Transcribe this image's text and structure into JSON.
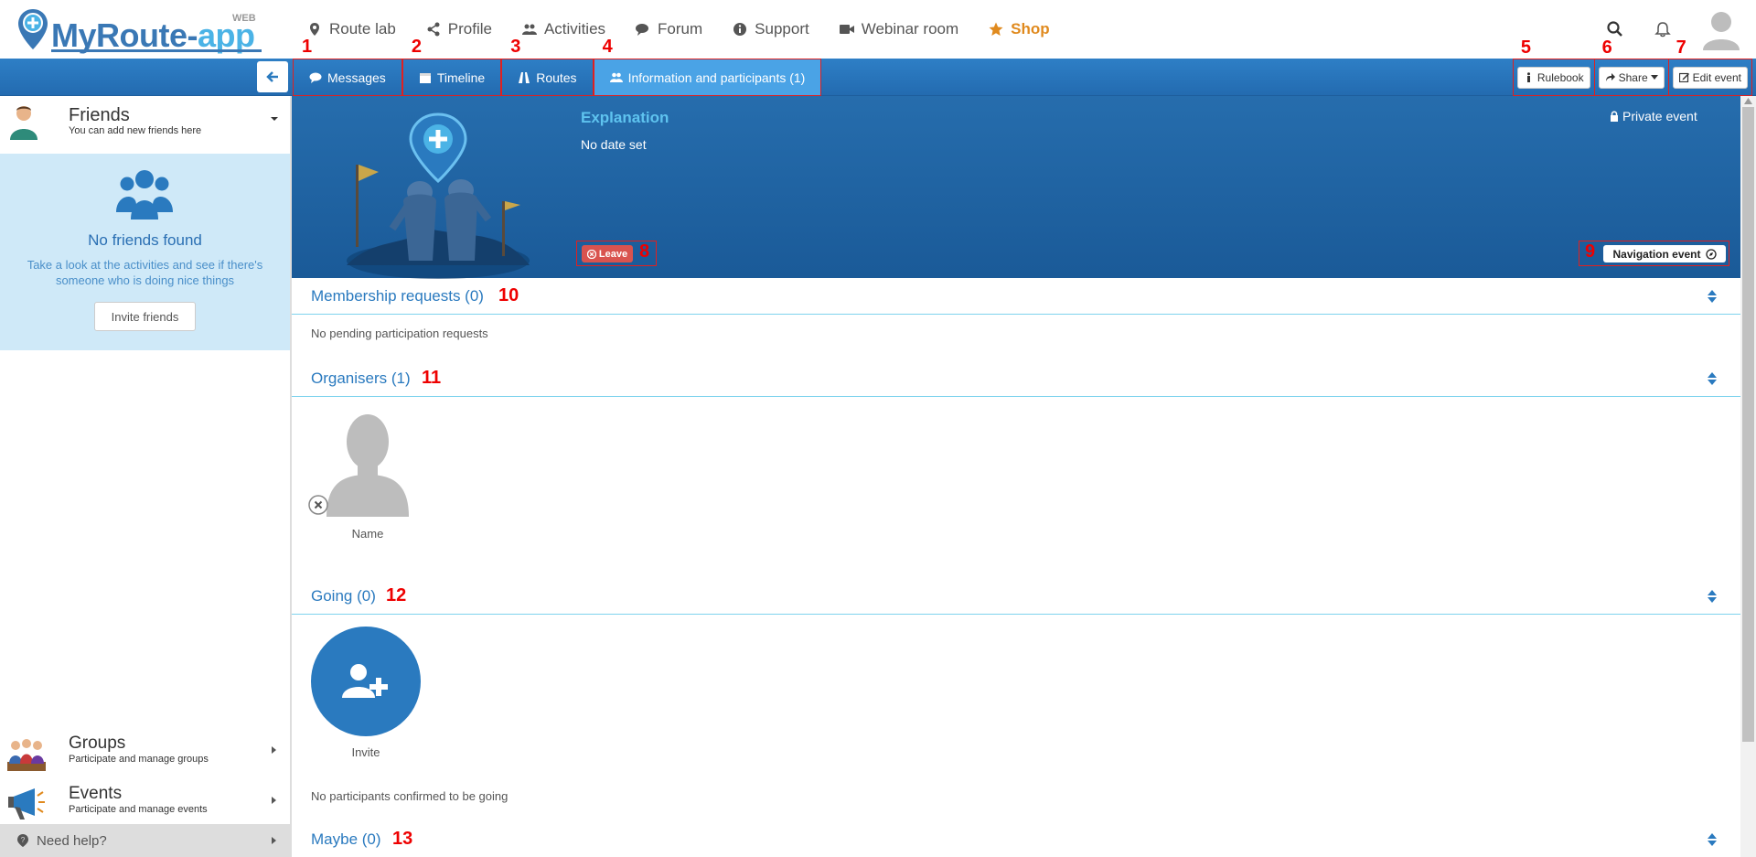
{
  "logo": {
    "main": "MyRoute-",
    "accent": "app",
    "badge": "WEB"
  },
  "nav": {
    "items": [
      {
        "label": "Route lab",
        "icon": "map-marker-icon"
      },
      {
        "label": "Profile",
        "icon": "share-nodes-icon"
      },
      {
        "label": "Activities",
        "icon": "users-icon"
      },
      {
        "label": "Forum",
        "icon": "comments-icon"
      },
      {
        "label": "Support",
        "icon": "info-icon"
      },
      {
        "label": "Webinar room",
        "icon": "video-camera-icon"
      },
      {
        "label": "Shop",
        "icon": "star-icon"
      }
    ]
  },
  "tabs": [
    {
      "num": "1",
      "label": "Messages",
      "icon": "comments-icon"
    },
    {
      "num": "2",
      "label": "Timeline",
      "icon": "calendar-icon"
    },
    {
      "num": "3",
      "label": "Routes",
      "icon": "road-icon"
    },
    {
      "num": "4",
      "label": "Information and participants (1)",
      "icon": "users-icon"
    }
  ],
  "actions": [
    {
      "num": "5",
      "label": "Rulebook",
      "icon": "info-icon"
    },
    {
      "num": "6",
      "label": "Share",
      "icon": "share-arrow-icon"
    },
    {
      "num": "7",
      "label": "Edit event",
      "icon": "edit-icon"
    }
  ],
  "sidebar": {
    "friends": {
      "title": "Friends",
      "subtitle": "You can add new friends here"
    },
    "empty": {
      "title": "No friends found",
      "text": "Take a look at the activities and see if there's someone who is doing nice things",
      "button": "Invite friends"
    },
    "groups": {
      "title": "Groups",
      "subtitle": "Participate and manage groups"
    },
    "events": {
      "title": "Events",
      "subtitle": "Participate and manage events"
    },
    "help": "Need help?"
  },
  "event": {
    "title": "Explanation",
    "date": "No date set",
    "privacy": "Private event",
    "leave_num": "8",
    "leave": "Leave",
    "nav_num": "9",
    "nav_event": "Navigation event"
  },
  "sections": {
    "membership": {
      "title": "Membership requests (0)",
      "num": "10",
      "text": "No pending participation requests"
    },
    "organisers": {
      "title": "Organisers (1)",
      "num": "11",
      "member_name": "Name"
    },
    "going": {
      "title": "Going (0)",
      "num": "12",
      "invite": "Invite",
      "text": "No participants confirmed to be going"
    },
    "maybe": {
      "title": "Maybe (0)",
      "num": "13"
    }
  },
  "colors": {
    "primary": "#2a7abf",
    "accent": "#4bb3e6",
    "shop": "#e08a1e",
    "danger": "#d9534f",
    "annotation": "#e02020"
  }
}
